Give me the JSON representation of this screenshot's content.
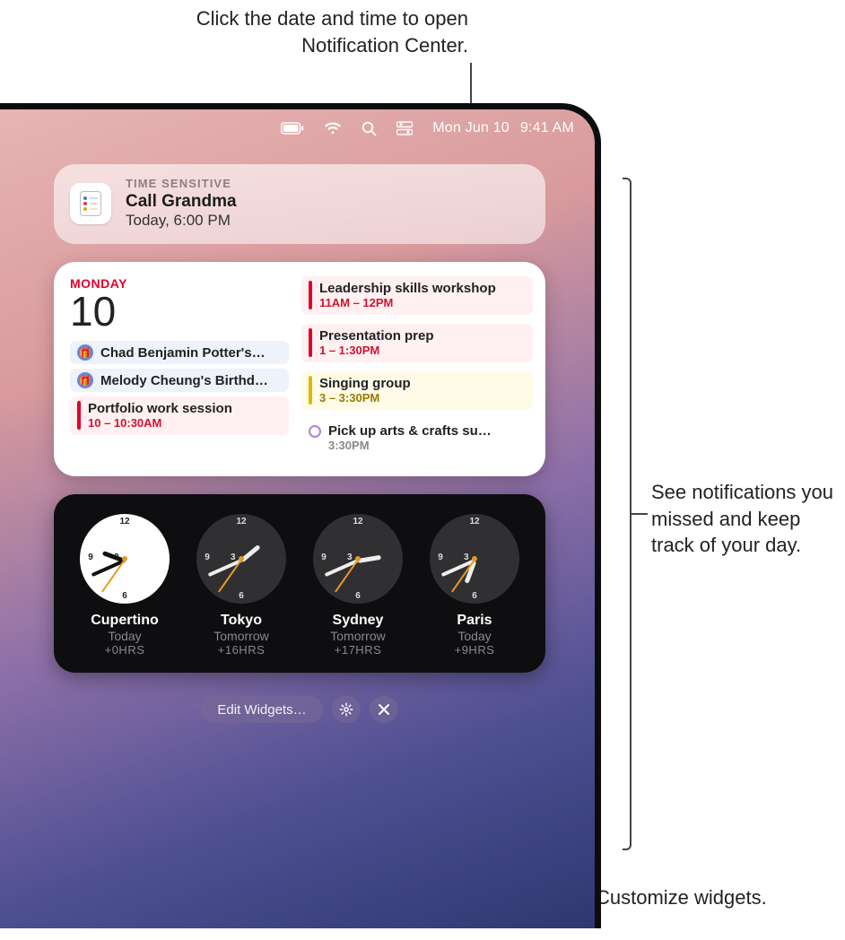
{
  "callouts": {
    "top": "Click the date and time to open Notification Center.",
    "right": "See notifications you missed and keep track of your day.",
    "bottom": "Customize widgets."
  },
  "menubar": {
    "date": "Mon Jun 10",
    "time": "9:41 AM"
  },
  "notification": {
    "eyebrow": "TIME SENSITIVE",
    "title": "Call Grandma",
    "subtitle": "Today, 6:00 PM"
  },
  "calendar": {
    "day_label": "MONDAY",
    "day_number": "10",
    "left_events": [
      {
        "kind": "allday",
        "title": "Chad Benjamin Potter's…"
      },
      {
        "kind": "allday",
        "title": "Melody Cheung's Birthd…"
      },
      {
        "kind": "block",
        "color": "red",
        "title": "Portfolio work session",
        "time": "10 – 10:30AM"
      }
    ],
    "right_events": [
      {
        "kind": "block",
        "color": "red",
        "title": "Leadership skills workshop",
        "time": "11AM – 12PM"
      },
      {
        "kind": "block",
        "color": "red",
        "title": "Presentation prep",
        "time": "1 – 1:30PM"
      },
      {
        "kind": "block",
        "color": "yel",
        "title": "Singing group",
        "time": "3 – 3:30PM"
      },
      {
        "kind": "ring",
        "title": "Pick up arts & crafts su…",
        "time": "3:30PM"
      }
    ]
  },
  "clocks": [
    {
      "city": "Cupertino",
      "dayrel": "Today",
      "offset": "+0HRS",
      "face": "day",
      "h": 9,
      "m": 41
    },
    {
      "city": "Tokyo",
      "dayrel": "Tomorrow",
      "offset": "+16HRS",
      "face": "night",
      "h": 1,
      "m": 41
    },
    {
      "city": "Sydney",
      "dayrel": "Tomorrow",
      "offset": "+17HRS",
      "face": "night",
      "h": 2,
      "m": 41
    },
    {
      "city": "Paris",
      "dayrel": "Today",
      "offset": "+9HRS",
      "face": "night",
      "h": 18,
      "m": 41
    }
  ],
  "editrow": {
    "label": "Edit Widgets…"
  }
}
